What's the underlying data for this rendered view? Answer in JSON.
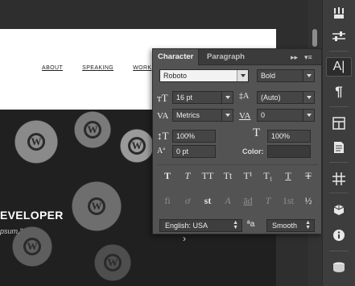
{
  "document": {
    "nav_items": [
      "ABOUT",
      "SPEAKING",
      "WORK"
    ],
    "heading": "EVELOPER",
    "subtext": "psum.\"",
    "chevron": "›"
  },
  "panel": {
    "tabs": [
      {
        "label": "Character",
        "active": true
      },
      {
        "label": "Paragraph",
        "active": false
      }
    ],
    "collapse_icon": "▸▸",
    "menu_icon": "▾≡",
    "font_family": "Roboto",
    "font_style": "Bold",
    "font_size": "16 pt",
    "leading": "(Auto)",
    "kerning": "Metrics",
    "tracking": "0",
    "vertical_scale": "100%",
    "horizontal_scale": "100%",
    "baseline_shift": "0 pt",
    "color_label": "Color:",
    "type_styles": [
      "T",
      "T",
      "TT",
      "Tt",
      "T¹",
      "T₁",
      "T",
      "T"
    ],
    "opentype": [
      "fi",
      "ơ",
      "st",
      "A",
      "ād",
      "T",
      "1st",
      "½"
    ],
    "language": "English: USA",
    "aa_icon": "ªa",
    "antialias": "Smooth"
  },
  "dock_icons": [
    "brushes-icon",
    "sliders-icon",
    "character-icon",
    "paragraph-icon",
    "swatches-icon",
    "notes-icon",
    "grid-icon",
    "3d-icon",
    "info-icon",
    "bucket-icon"
  ]
}
